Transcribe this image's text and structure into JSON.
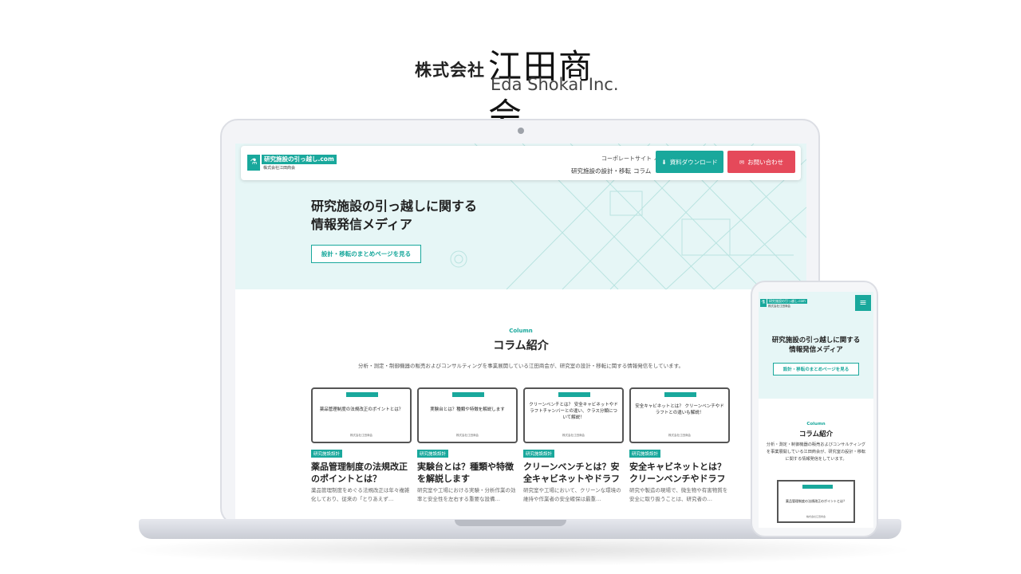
{
  "brand": {
    "kabushiki": "株式会社",
    "name": "江田商会",
    "english": "Eda Shokai Inc."
  },
  "site": {
    "logo_title": "研究施設の引っ越し.com",
    "logo_sub": "株式会社江田商会",
    "corporate_link": "コーポレートサイト",
    "nav": [
      "研究施設の設計・移転",
      "コラム"
    ],
    "download_btn": "資料ダウンロード",
    "contact_btn": "お問い合わせ",
    "hero_title_line1": "研究施設の引っ越しに関する",
    "hero_title_line2": "情報発信メディア",
    "hero_btn": "設計・移転のまとめページを見る",
    "section_label": "Column",
    "section_title": "コラム紹介",
    "section_desc": "分析・測定・制御機器の販売およびコンサルティングを事業展開している江田商会が、研究室の設計・移転に関する情報発信をしています。",
    "cards": [
      {
        "thumb_text": "薬品管理制度の法規改正のポイントとは？",
        "thumb_sub": "株式会社江田商会",
        "tag": "研究施設設計",
        "title": "薬品管理制度の法規改正のポイントとは？",
        "excerpt": "薬品管理制度をめぐる法規改正は年々複雑化しており、従来の「とりあえず…"
      },
      {
        "thumb_text": "実験台とは？種類や特徴を解説します",
        "thumb_sub": "株式会社江田商会",
        "tag": "研究施設設計",
        "title": "実験台とは？種類や特徴を解説します",
        "excerpt": "研究室や工場における実験・分析作業の効率と安全性を左右する重要な設備…"
      },
      {
        "thumb_text": "クリーンベンチとは？ 安全キャビネットやドラフトチャンバーとの違い、クラス分類について解説！",
        "thumb_sub": "株式会社江田商会",
        "tag": "研究施設設計",
        "title": "クリーンベンチとは？安全キャビネットやドラフト…",
        "excerpt": "研究室や工場において、クリーンな環境の維持や作業者の安全確保は最重…"
      },
      {
        "thumb_text": "安全キャビネットとは？ クリーンベンチやドラフトとの違いも解説！",
        "thumb_sub": "株式会社江田商会",
        "tag": "研究施設設計",
        "title": "安全キャビネットとは？クリーンベンチやドラフト…",
        "excerpt": "研究や製造の現場で、微生物や有害物質を安全に取り扱うことは、研究者の…"
      }
    ]
  },
  "mobile": {
    "logo_title": "研究施設の引っ越し.com",
    "logo_sub": "株式会社江田商会",
    "hero_title_line1": "研究施設の引っ越しに関する",
    "hero_title_line2": "情報発信メディア",
    "hero_btn": "設計・移転のまとめページを見る",
    "section_label": "Column",
    "section_title": "コラム紹介",
    "section_desc": "分析・測定・制御機器の販売およびコンサルティングを事業展開している江田商会が、研究室の設計・移転に関する情報発信をしています。",
    "card_thumb_text": "薬品管理制度の法規改正のポイントとは？",
    "card_thumb_sub": "株式会社江田商会"
  },
  "colors": {
    "accent": "#19a89c",
    "contact": "#e5495a",
    "hero_bg": "#e6f6f6"
  },
  "icons": {
    "logo": "flask-icon",
    "download": "download-icon",
    "contact": "mail-icon",
    "external": "external-link-icon",
    "menu": "hamburger-icon"
  }
}
